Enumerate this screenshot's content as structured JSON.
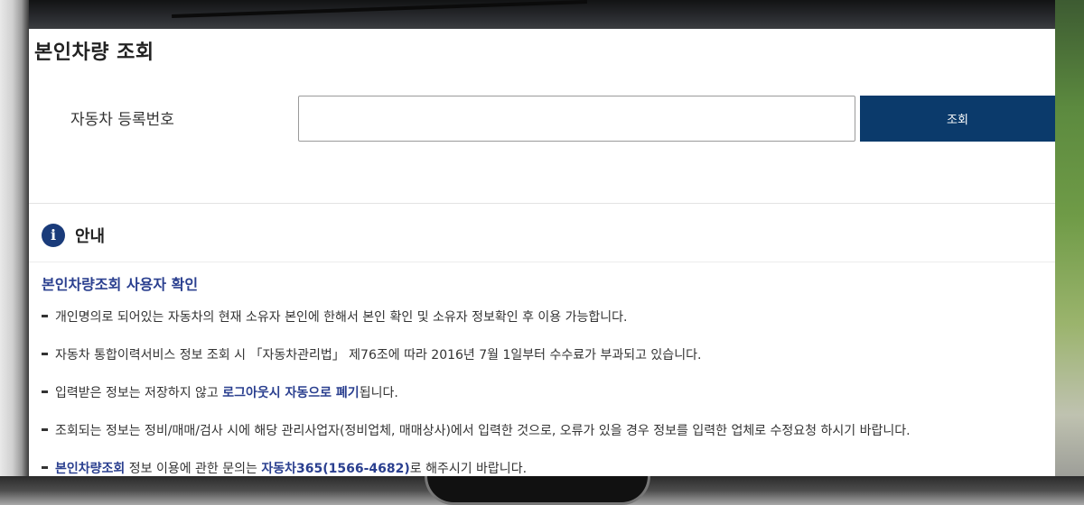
{
  "page": {
    "title": "본인차량 조회"
  },
  "search": {
    "label": "자동차 등록번호",
    "value": "",
    "placeholder": "",
    "button_label": "조회"
  },
  "guide": {
    "icon": "info-icon",
    "icon_glyph": "i",
    "title": "안내",
    "section_heading": "본인차량조회 사용자 확인",
    "items": [
      {
        "text": "개인명의로 되어있는 자동차의 현재 소유자 본인에 한해서 본인 확인 및 소유자 정보확인 후 이용 가능합니다."
      },
      {
        "text": "자동차 통합이력서비스 정보 조회 시 「자동차관리법」 제76조에 따라 2016년 7월 1일부터 수수료가 부과되고 있습니다."
      },
      {
        "text_before": "입력받은 정보는 저장하지 않고 ",
        "highlight": "로그아웃시 자동으로 폐기",
        "text_after": "됩니다."
      },
      {
        "text": "조회되는 정보는 정비/매매/검사 시에 해당 관리사업자(정비업체, 매매상사)에서 입력한 것으로, 오류가 있을 경우 정보를 입력한 업체로 수정요청 하시기 바랍니다."
      },
      {
        "highlight1": "본인차량조회",
        "text_middle": " 정보 이용에 관한 문의는 ",
        "highlight2": "자동차365(1566-4682)",
        "text_after": "로 해주시기 바랍니다."
      }
    ]
  },
  "colors": {
    "primary_button": "#0b3a6b",
    "heading_blue": "#2a3f8f",
    "info_icon_bg": "#1a3b7a"
  }
}
